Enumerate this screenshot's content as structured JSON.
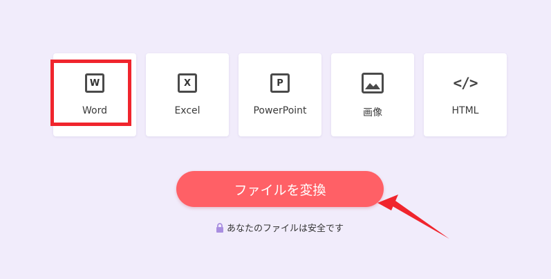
{
  "formats": [
    {
      "label": "Word",
      "icon": "word-icon",
      "glyph": "W"
    },
    {
      "label": "Excel",
      "icon": "excel-icon",
      "glyph": "X"
    },
    {
      "label": "PowerPoint",
      "icon": "powerpoint-icon",
      "glyph": "P"
    },
    {
      "label": "画像",
      "icon": "image-icon"
    },
    {
      "label": "HTML",
      "icon": "code-icon",
      "glyph": "</>"
    }
  ],
  "convert_button": {
    "label": "ファイルを変換"
  },
  "security_note": {
    "text": "あなたのファイルは安全です",
    "icon": "lock-icon"
  },
  "colors": {
    "background": "#f1ecfb",
    "button": "#ff6066",
    "highlight": "#f0252d",
    "lock": "#a98ee0"
  }
}
